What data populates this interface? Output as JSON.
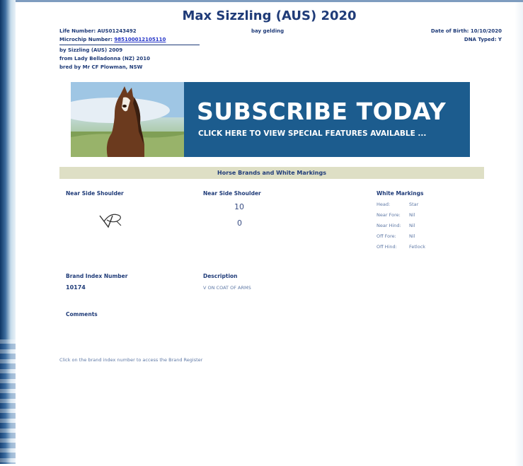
{
  "header": {
    "title": "Max Sizzling (AUS) 2020",
    "life_number": "Life Number: AUS01243492",
    "microchip_label": "Microchip Number:",
    "microchip_value": "985100012105110",
    "sex_colour": "bay gelding",
    "dob": "Date of Birth: 10/10/2020",
    "dna": "DNA Typed: Y",
    "sire": "by Sizzling (AUS) 2009",
    "dam": "from Lady Belladonna (NZ) 2010",
    "breeder": "bred by Mr CF Plowman, NSW"
  },
  "banner": {
    "headline": "SUBSCRIBE TODAY",
    "subline": "CLICK HERE TO VIEW SPECIAL FEATURES AVAILABLE ...",
    "bg_color": "#1c5c8e"
  },
  "brands": {
    "section_title": "Horse Brands and White Markings",
    "near_side_shoulder_1": "Near Side Shoulder",
    "near_side_shoulder_2": "Near Side Shoulder",
    "brand_top": "10",
    "brand_bottom": "0",
    "white_markings_title": "White Markings",
    "markings": [
      {
        "label": "Head:",
        "value": "Star"
      },
      {
        "label": "Near Fore:",
        "value": "Nil"
      },
      {
        "label": "Near Hind:",
        "value": "Nil"
      },
      {
        "label": "Off Fore:",
        "value": "Nil"
      },
      {
        "label": "Off Hind:",
        "value": "Fetlock"
      }
    ],
    "brand_index_label": "Brand Index Number",
    "brand_index_value": "10174",
    "description_label": "Description",
    "description_value": "V ON COAT OF ARMS",
    "comments_label": "Comments"
  },
  "footer": {
    "note": "Click on the brand index number to access the Brand Register"
  }
}
